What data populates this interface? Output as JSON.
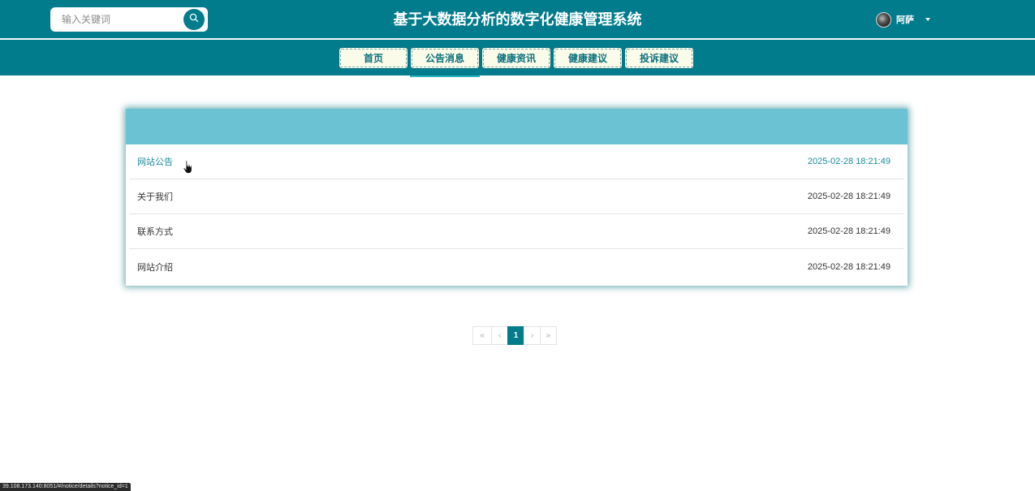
{
  "header": {
    "title": "基于大数据分析的数字化健康管理系统",
    "search": {
      "placeholder": "输入关键词",
      "value": ""
    },
    "user": {
      "name": "阿萨"
    }
  },
  "nav": {
    "items": [
      {
        "label": "首页"
      },
      {
        "label": "公告消息"
      },
      {
        "label": "健康资讯"
      },
      {
        "label": "健康建议"
      },
      {
        "label": "投诉建议"
      }
    ],
    "active_index": 1
  },
  "notices": [
    {
      "title": "网站公告",
      "time": "2025-02-28 18:21:49"
    },
    {
      "title": "关于我们",
      "time": "2025-02-28 18:21:49"
    },
    {
      "title": "联系方式",
      "time": "2025-02-28 18:21:49"
    },
    {
      "title": "网站介绍",
      "time": "2025-02-28 18:21:49"
    }
  ],
  "pagination": {
    "first": "«",
    "prev": "‹",
    "current": "1",
    "next": "›",
    "last": "»"
  },
  "status_bar": {
    "url": "39.108.173.140:8051/#/notice/details?notice_id=1"
  },
  "colors": {
    "primary": "#007c8c",
    "panel_header": "#6ac2d2",
    "nav_button_bg": "#fbfbe9",
    "hover_text": "#1b8a9b"
  },
  "icons": {
    "search": "search-icon",
    "avatar": "avatar",
    "dropdown": "caret-down-icon",
    "cursor": "hand-pointer-icon"
  }
}
